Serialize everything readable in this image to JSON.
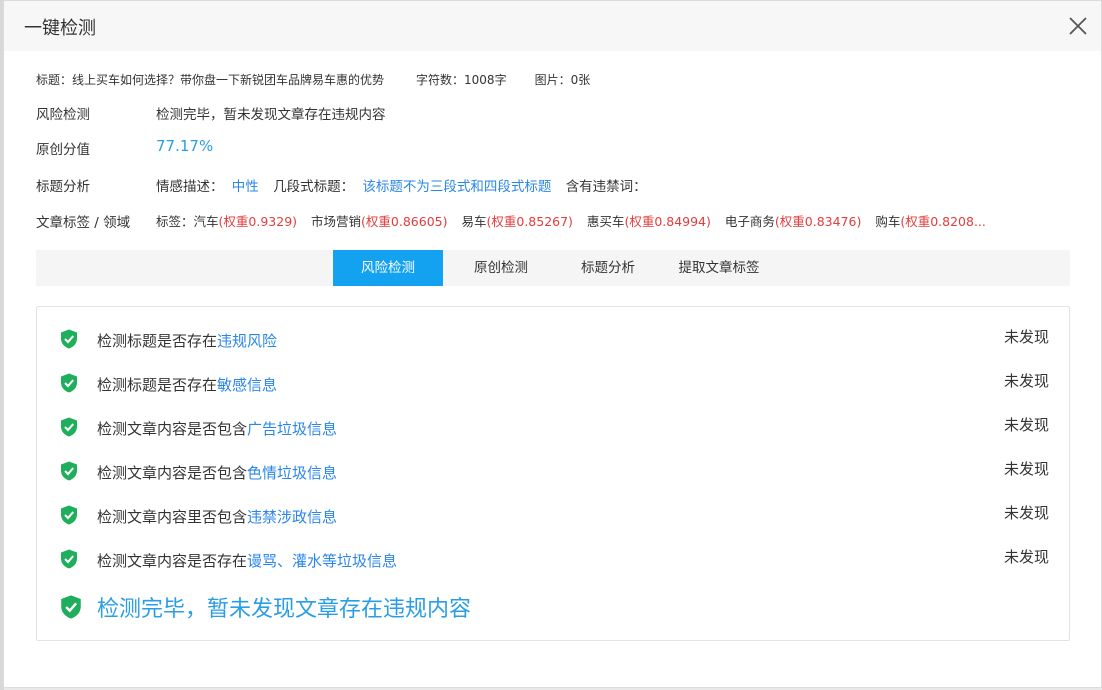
{
  "dialog": {
    "title": "一键检测",
    "close_icon": "close-icon"
  },
  "article": {
    "title_label": "标题：",
    "title": "线上买车如何选择？带你盘一下新锐团车品牌易车惠的优势",
    "char_count": "字符数：1008字",
    "image_count": "图片：0张"
  },
  "risk": {
    "label": "风险检测",
    "value": "检测完毕，暂未发现文章存在违规内容"
  },
  "originality": {
    "label": "原创分值",
    "value": "77.17%"
  },
  "title_analysis": {
    "label": "标题分析",
    "sentiment_label": "情感描述：",
    "sentiment": "中性",
    "segment_label": "几段式标题：",
    "segment": "该标题不为三段式和四段式标题",
    "banned_label": "含有违禁词："
  },
  "tags": {
    "label": "文章标签 / 领域",
    "prefix": "标签：",
    "items": [
      {
        "name": "汽车",
        "weight": "(权重0.9329)"
      },
      {
        "name": "市场营销",
        "weight": "(权重0.86605)"
      },
      {
        "name": "易车",
        "weight": "(权重0.85267)"
      },
      {
        "name": "惠买车",
        "weight": "(权重0.84994)"
      },
      {
        "name": "电子商务",
        "weight": "(权重0.83476)"
      },
      {
        "name": "购车",
        "weight": "(权重0.8208..."
      }
    ]
  },
  "tabs": [
    {
      "label": "风险检测",
      "active": true
    },
    {
      "label": "原创检测",
      "active": false
    },
    {
      "label": "标题分析",
      "active": false
    },
    {
      "label": "提取文章标签",
      "active": false
    }
  ],
  "checks": [
    {
      "prefix": "检测标题是否存在",
      "highlight": "违规风险",
      "result": "未发现"
    },
    {
      "prefix": "检测标题是否存在",
      "highlight": "敏感信息",
      "result": "未发现"
    },
    {
      "prefix": "检测文章内容是否包含",
      "highlight": "广告垃圾信息",
      "result": "未发现"
    },
    {
      "prefix": "检测文章内容是否包含",
      "highlight": "色情垃圾信息",
      "result": "未发现"
    },
    {
      "prefix": "检测文章内容里否包含",
      "highlight": "违禁涉政信息",
      "result": "未发现"
    },
    {
      "prefix": "检测文章内容是否存在",
      "highlight": "谩骂、灌水等垃圾信息",
      "result": "未发现"
    }
  ],
  "summary": "检测完毕，暂未发现文章存在违规内容",
  "colors": {
    "accent": "#12a2f0",
    "link": "#2a86e8",
    "weight_red": "#e33c3c",
    "shield_green": "#1fae5b"
  }
}
